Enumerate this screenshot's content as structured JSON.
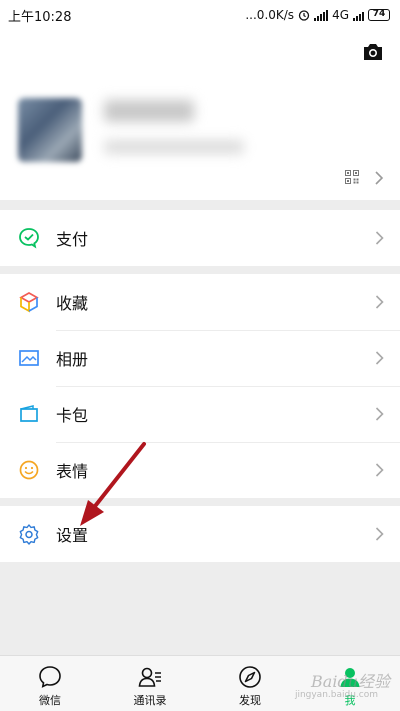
{
  "status_bar": {
    "time": "上午10:28",
    "network_speed": "...0.0K/s",
    "network_type": "4G",
    "battery": "74"
  },
  "profile": {
    "camera_icon": "camera-icon",
    "qr_icon": "qr-code-icon"
  },
  "menu": {
    "pay": {
      "label": "支付",
      "icon": "wechat-pay-icon",
      "color": "#07c160"
    },
    "favorites": {
      "label": "收藏",
      "icon": "cube-icon"
    },
    "album": {
      "label": "相册",
      "icon": "image-icon",
      "color": "#3e8ef7"
    },
    "cards": {
      "label": "卡包",
      "icon": "wallet-icon",
      "color": "#1aa3e0"
    },
    "stickers": {
      "label": "表情",
      "icon": "smile-icon",
      "color": "#f5a623"
    },
    "settings": {
      "label": "设置",
      "icon": "gear-icon",
      "color": "#2e7bd6"
    }
  },
  "tabbar": {
    "chats": "微信",
    "contacts": "通讯录",
    "discover": "发现",
    "me": "我",
    "active_color": "#07c160"
  },
  "watermark": {
    "text": "Baidu经验",
    "sub": "jingyan.baidu.com"
  }
}
